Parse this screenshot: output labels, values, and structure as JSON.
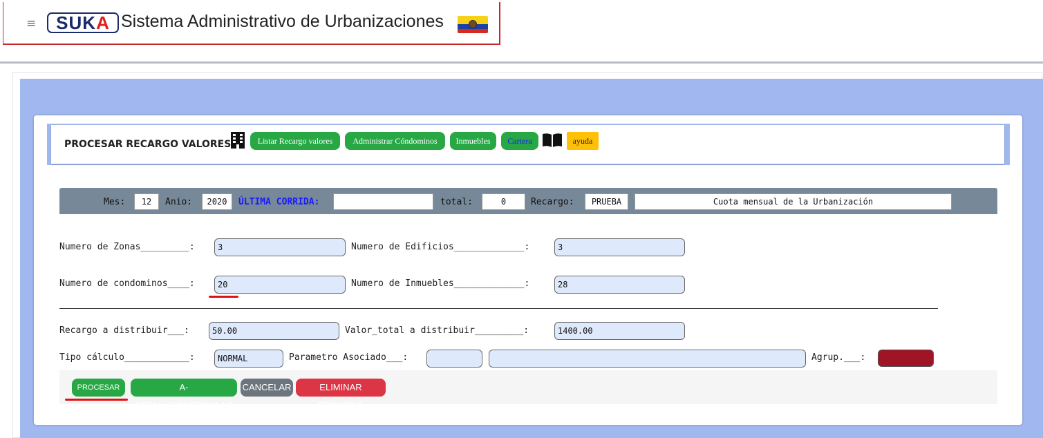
{
  "header": {
    "menu_icon": "hamburger-icon",
    "logo": {
      "part1": "SUK",
      "part2": "A"
    },
    "title": "Sistema Administrativo de Urbanizaciones",
    "flag_icon": "ecuador-flag-icon"
  },
  "panel": {
    "title": "PROCESAR RECARGO VALORES",
    "building_icon": "building-icon",
    "buttons": {
      "listar": "Listar Recargo valores",
      "administrar": "Administrar Cóndominos",
      "inmuebles": "Inmuebles",
      "cartera": "Cartera",
      "ayuda": "ayuda"
    },
    "book_icon": "book-icon"
  },
  "summary": {
    "mes_label": "Mes:",
    "mes_value": "12",
    "anio_label": "Anio:",
    "anio_value": "2020",
    "ultima_label": "ÚLTIMA CORRIDA:",
    "ultima_value": "",
    "total_label": "total:",
    "total_value": "0",
    "recargo_label": "Recargo:",
    "recargo_value": "PRUEBA",
    "descripcion_value": "Cuota mensual de la Urbanización"
  },
  "form": {
    "zonas_label": "Numero de Zonas_________:",
    "zonas_value": "3",
    "edificios_label": "Numero de Edificios_____________:",
    "edificios_value": "3",
    "condominos_label": "Numero de condominos____:",
    "condominos_value": "20",
    "inmuebles_label": "Numero de Inmuebles_____________:",
    "inmuebles_value": "28",
    "recargo_dist_label": "Recargo a distribuir___:",
    "recargo_dist_value": "50.00",
    "valor_total_label": "Valor_total a distribuir_________:",
    "valor_total_value": "1400.00",
    "tipo_label": "Tipo cálculo____________:",
    "tipo_value": "NORMAL",
    "parametro_label": "Parametro Asociado___:",
    "parametro_value1": "",
    "parametro_value2": "",
    "agrup_label": "Agrup.___:",
    "agrup_color": "#a01525"
  },
  "actions": {
    "procesar": "PROCESAR",
    "detalle": "A-DETALLE/PARTICULAR",
    "cancelar": "CANCELAR",
    "eliminar": "ELIMINAR PROCESO"
  },
  "colors": {
    "accent_blue": "#a0b8ef",
    "success": "#28a745",
    "danger": "#dc3545",
    "secondary": "#6c757d",
    "warning": "#ffc107"
  }
}
